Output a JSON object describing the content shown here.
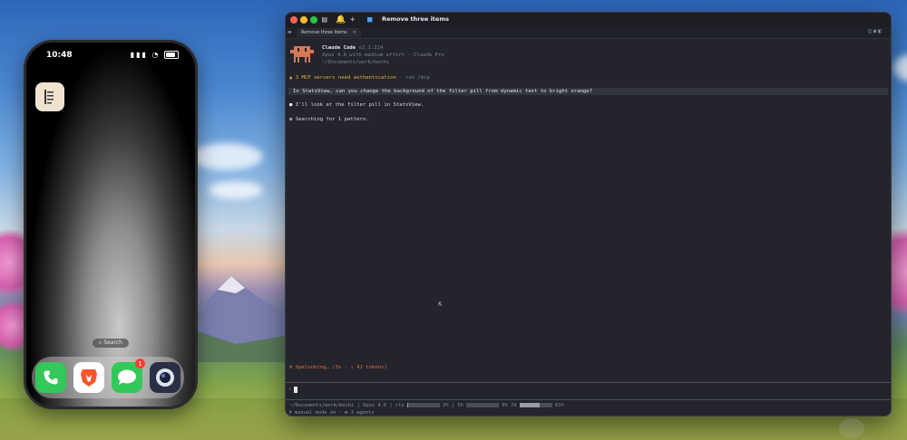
{
  "phone": {
    "time": "10:48",
    "search_label": "Search",
    "dock_apps": [
      {
        "name": "Phone",
        "icon": "phone-icon",
        "color": "#34c759"
      },
      {
        "name": "Brave",
        "icon": "brave-lion-icon",
        "color": "#fb542b"
      },
      {
        "name": "Messages",
        "icon": "message-bubble-icon",
        "color": "#34c759",
        "badge": "1"
      },
      {
        "name": "Camera",
        "icon": "camera-lens-icon",
        "color": "#2b2f45"
      }
    ]
  },
  "window": {
    "title": "Remove three items",
    "tab_label": "Remove three items"
  },
  "terminal": {
    "app_name": "Claude Code",
    "version": "v2.1.214",
    "model_line": "Opus 4.6 with medium effort · Claude Pro",
    "path": "~/Documents/work/mochi",
    "warning": "▲ 3 MCP servers need authentication",
    "warning_hint": "· run /mcp",
    "user_prompt": "In StatsView, can you change the background of the filter pill from dynamic text to bright orange?",
    "reply_line": "I'll look at the filter pill in StatsView.",
    "search_line": "Searching for 1 pattern.",
    "spinner_text": "✻ Spelunking… (3s · ↓ 41 tokens)",
    "status": {
      "path": "~/Documents/work/mochi",
      "model": "Opus 4.6",
      "ctx_label": "ctx",
      "ctx_pct": "2%",
      "ctx_fill": 0.02,
      "five_h_label": "5h",
      "five_h_pct": "0%",
      "five_h_fill": 0.0,
      "seven_d_label": "7d",
      "seven_d_pct": "61%",
      "seven_d_fill": 0.61
    },
    "mode_line": "⏵ manual mode on · ⊞ 3 agents"
  }
}
